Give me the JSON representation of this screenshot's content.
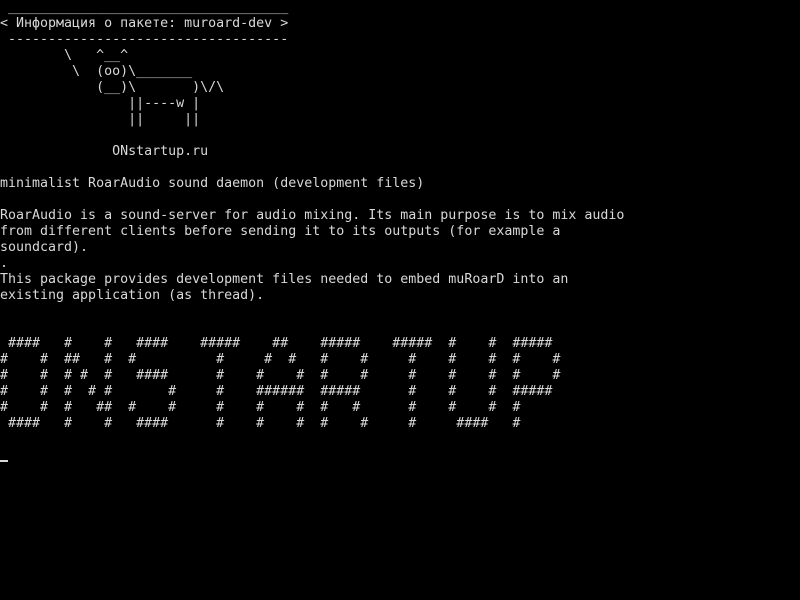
{
  "cowsay": {
    "border_top": " ___________________________________",
    "message": "< Информация о пакете: muroard-dev >",
    "border_bottom": " -----------------------------------",
    "cow": [
      "        \\   ^__^",
      "         \\  (oo)\\_______",
      "            (__)\\       )\\/\\",
      "                ||----w |",
      "                ||     ||"
    ],
    "signature": "              ONstartup.ru"
  },
  "package": {
    "summary": "minimalist RoarAudio sound daemon (development files)",
    "description": [
      "RoarAudio is a sound-server for audio mixing. Its main purpose is to mix audio",
      "from different clients before sending it to its outputs (for example a",
      "soundcard).",
      ".",
      "This package provides development files needed to embed muRoarD into an",
      "existing application (as thread)."
    ]
  },
  "banner": [
    " ####   #    #   ####    #####    ##    #####    #####  #    #  #####",
    "#    #  ##   #  #          #     #  #   #    #     #    #    #  #    #",
    "#    #  # #  #   ####      #    #    #  #    #     #    #    #  #    #",
    "#    #  #  # #       #     #    ######  #####      #    #    #  #####",
    "#    #  #   ##  #    #     #    #    #  #   #      #    #    #  #",
    " ####   #    #   ####      #    #    #  #    #     #     ####   #"
  ]
}
